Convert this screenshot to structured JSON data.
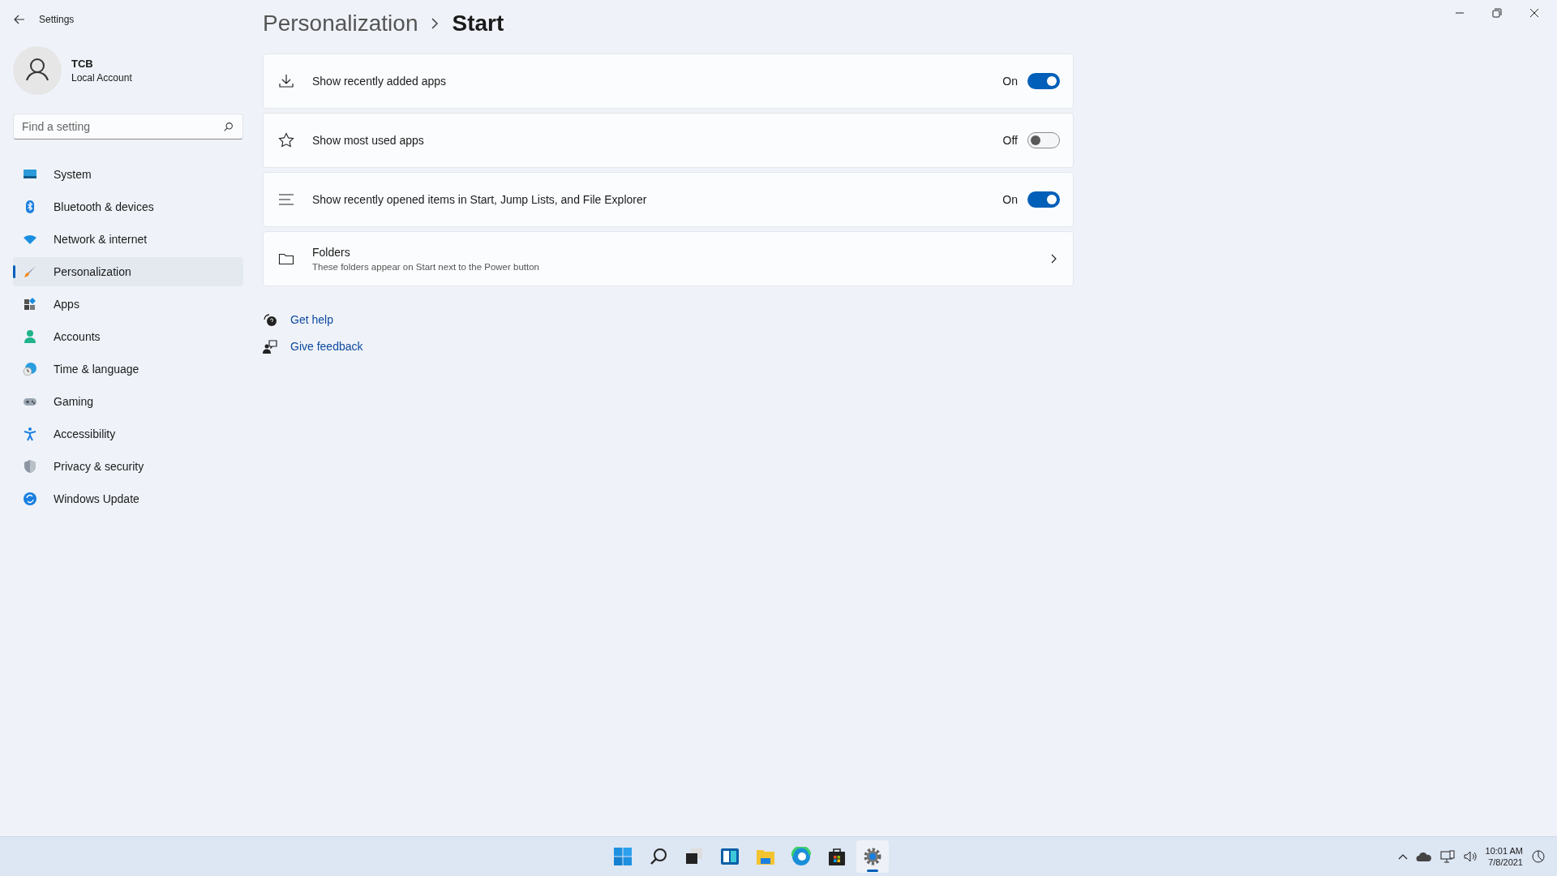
{
  "window": {
    "title": "Settings"
  },
  "user": {
    "name": "TCB",
    "account_type": "Local Account"
  },
  "search": {
    "placeholder": "Find a setting"
  },
  "nav": [
    {
      "label": "System",
      "selected": false
    },
    {
      "label": "Bluetooth & devices",
      "selected": false
    },
    {
      "label": "Network & internet",
      "selected": false
    },
    {
      "label": "Personalization",
      "selected": true
    },
    {
      "label": "Apps",
      "selected": false
    },
    {
      "label": "Accounts",
      "selected": false
    },
    {
      "label": "Time & language",
      "selected": false
    },
    {
      "label": "Gaming",
      "selected": false
    },
    {
      "label": "Accessibility",
      "selected": false
    },
    {
      "label": "Privacy & security",
      "selected": false
    },
    {
      "label": "Windows Update",
      "selected": false
    }
  ],
  "breadcrumb": [
    "Personalization",
    "Start"
  ],
  "settings": [
    {
      "kind": "toggle",
      "label": "Show recently added apps",
      "state": "On",
      "on": true
    },
    {
      "kind": "toggle",
      "label": "Show most used apps",
      "state": "Off",
      "on": false
    },
    {
      "kind": "toggle",
      "label": "Show recently opened items in Start, Jump Lists, and File Explorer",
      "state": "On",
      "on": true
    },
    {
      "kind": "link",
      "label": "Folders",
      "description": "These folders appear on Start next to the Power button"
    }
  ],
  "links": [
    "Get help",
    "Give feedback"
  ],
  "taskbar": {
    "apps": [
      {
        "selected": false
      },
      {
        "selected": false
      },
      {
        "selected": false
      },
      {
        "selected": false
      },
      {
        "selected": false
      },
      {
        "selected": false
      },
      {
        "selected": false
      },
      {
        "selected": true
      }
    ],
    "time": "10:01 AM",
    "date": "7/8/2021"
  }
}
